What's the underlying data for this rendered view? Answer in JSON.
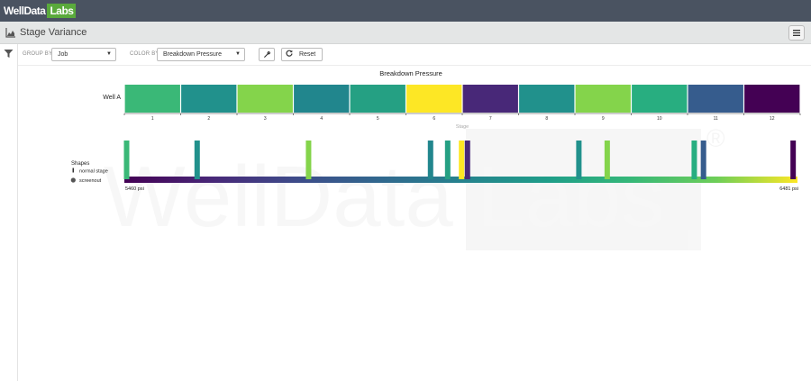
{
  "app": {
    "logo_text": "WellData",
    "logo_badge": "Labs",
    "watermark_text": "WellData Labs",
    "watermark_mark": "®"
  },
  "header": {
    "title": "Stage Variance"
  },
  "toolbar": {
    "group_by_label": "GROUP BY",
    "group_by_value": "Job",
    "color_by_label": "COLOR BY",
    "color_by_value": "Breakdown Pressure",
    "reset_label": "Reset"
  },
  "colors": {
    "topbar": "#4a5361",
    "brand_green": "#5aaa3c"
  },
  "chart_data": {
    "type": "heatmap",
    "title": "Breakdown Pressure",
    "xlabel": "Stage",
    "row_label": "Well A",
    "stages": [
      1,
      2,
      3,
      4,
      5,
      6,
      7,
      8,
      9,
      10,
      11,
      12
    ],
    "stage_colors": [
      "#3ab877",
      "#21918c",
      "#84d44b",
      "#21868d",
      "#25a083",
      "#fde725",
      "#482878",
      "#21918c",
      "#84d44b",
      "#28ae80",
      "#365c8d",
      "#440154"
    ],
    "legend": {
      "title": "Shapes",
      "items": [
        "normal stage",
        "screenout"
      ],
      "min_label": "5460 psi",
      "max_label": "6481 psi",
      "min": 5460,
      "max": 6481,
      "marks": [
        5460,
        5567,
        5736,
        5921,
        5947,
        5968,
        5977,
        6146,
        6189,
        6321,
        6335,
        6471
      ]
    }
  }
}
